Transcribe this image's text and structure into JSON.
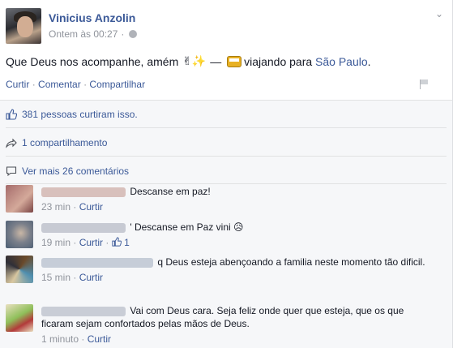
{
  "post": {
    "author": "Vinicius Anzolin",
    "timestamp": "Ontem às 00:27",
    "text_prefix": "Que Deus nos acompanhe, amém",
    "emojis": "✌✨",
    "dash": "—",
    "activity": "viajando para",
    "place": "São Paulo",
    "period": ".",
    "actions": {
      "like": "Curtir",
      "comment": "Comentar",
      "share": "Compartilhar",
      "separator": "·"
    }
  },
  "likes_text": "381 pessoas curtiram isso.",
  "shares_text": "1 compartilhamento",
  "more_comments": "Ver mais 26 comentários",
  "comments": [
    {
      "text": "Descanse em paz!",
      "time": "23 min",
      "reply": "Curtir",
      "avatar_colors": [
        "#a56b6b",
        "#d4a99a"
      ],
      "name_color": "#d8c0bc"
    },
    {
      "text": "' Descanse em Paz vini",
      "emoji": "😥",
      "time": "19 min",
      "reply": "Curtir",
      "likes": "1",
      "avatar_colors": [
        "#4a5d73",
        "#c9b7a6"
      ],
      "name_color": "#c7cad3"
    },
    {
      "text": "q Deus esteja abençoando a familia neste momento tão dificil.",
      "time": "15 min",
      "reply": "Curtir",
      "avatar_colors": [
        "#6a4a2a",
        "#4f8fb0"
      ],
      "name_color": "#c6cdd8"
    },
    {
      "text": "Vai com Deus cara. Seja feliz onde quer que esteja, que os que ficaram sejam confortados pelas mãos de Deus.",
      "time": "1 minuto",
      "reply": "Curtir",
      "avatar_colors": [
        "#8fbf5a",
        "#e9e0c0"
      ],
      "name_color": "#c9cdd6"
    }
  ],
  "colors": {
    "link": "#3b5998",
    "muted": "#90949c",
    "band": "#f6f7f9"
  }
}
